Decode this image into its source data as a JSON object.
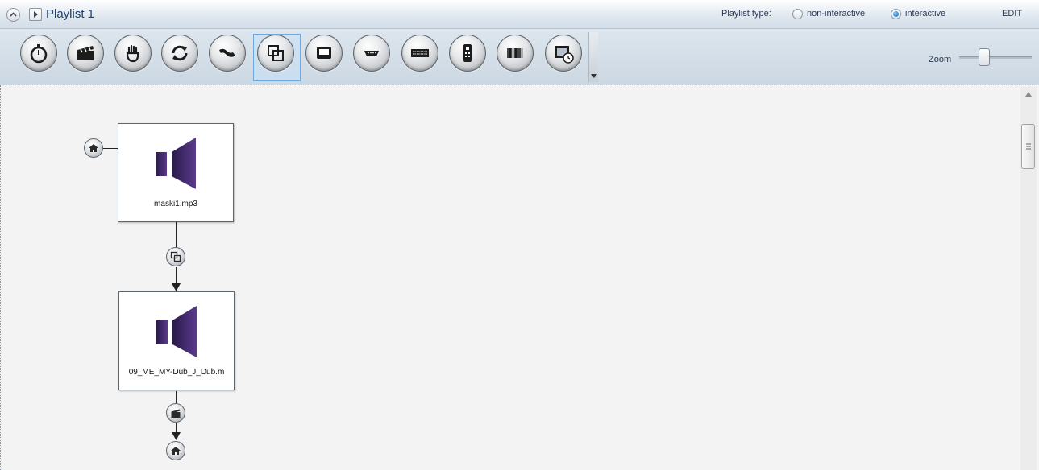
{
  "window": {
    "title": "Playlist 1",
    "playlist_type_label": "Playlist type:",
    "options": [
      {
        "label": "non-interactive",
        "selected": false
      },
      {
        "label": "interactive",
        "selected": true
      }
    ],
    "edit_label": "EDIT"
  },
  "toolbar": {
    "tools": [
      {
        "icon": "stopwatch-icon"
      },
      {
        "icon": "clapperboard-icon"
      },
      {
        "icon": "touch-hand-icon"
      },
      {
        "icon": "refresh-icon"
      },
      {
        "icon": "cable-icon"
      },
      {
        "icon": "overlap-squares-icon",
        "selected": true
      },
      {
        "icon": "monitor-icon"
      },
      {
        "icon": "serial-port-icon"
      },
      {
        "icon": "keyboard-icon"
      },
      {
        "icon": "remote-control-icon"
      },
      {
        "icon": "barcode-icon"
      },
      {
        "icon": "film-clock-icon"
      }
    ],
    "zoom_label": "Zoom",
    "zoom_level": 0.3
  },
  "flow": {
    "nodes": [
      {
        "file": "maski1.mp3",
        "icon": "speaker-icon"
      },
      {
        "file": "09_ME_MY-Dub_J_Dub.m",
        "icon": "speaker-icon"
      }
    ],
    "connectors": [
      {
        "icon": "home-icon"
      },
      {
        "icon": "overlap-squares-icon"
      },
      {
        "icon": "clapperboard-icon"
      },
      {
        "icon": "home-icon"
      }
    ]
  },
  "colors": {
    "accent": "#6fa8dc",
    "speaker": "#3b2366",
    "title": "#1f3f6d"
  }
}
